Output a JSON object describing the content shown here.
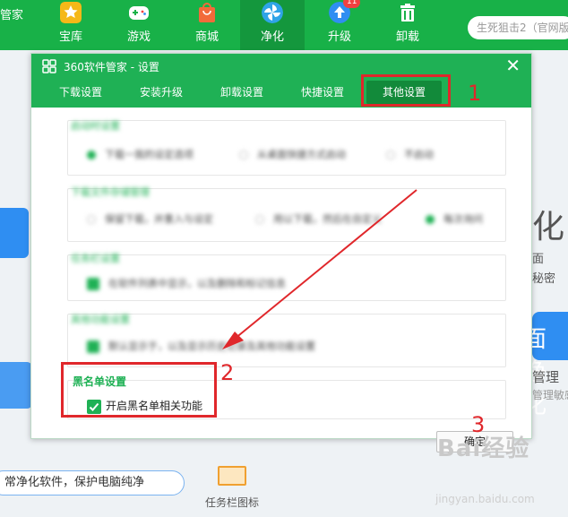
{
  "topbar": {
    "brand_fragment": "管家",
    "nav": [
      {
        "label": "宝库",
        "icon": "star-icon",
        "color": "#f5b818"
      },
      {
        "label": "游戏",
        "icon": "gamepad-icon",
        "color": "#ffffff"
      },
      {
        "label": "商城",
        "icon": "shopping-bag-icon",
        "color": "#f26b3a"
      },
      {
        "label": "净化",
        "icon": "fan-icon",
        "color": "#2fa4e7",
        "active": true
      },
      {
        "label": "升级",
        "icon": "upgrade-arrow-icon",
        "color": "#2f8ef2",
        "badge": "11"
      },
      {
        "label": "卸载",
        "icon": "trash-icon",
        "color": "#ffffff"
      }
    ],
    "search_placeholder": "生死狙击2（官网版"
  },
  "background": {
    "side_char": "化",
    "side_text_1": "面",
    "side_text_2": "秘密",
    "side_text_3": "面净化",
    "side_text_4": "管理",
    "side_text_5": "管理敏感",
    "bottom_pill": "常净化软件，保护电脑纯净",
    "tray_label": "任务栏图标"
  },
  "dialog": {
    "title": "360软件管家 - 设置",
    "tabs": [
      {
        "label": "下载设置"
      },
      {
        "label": "安装升级"
      },
      {
        "label": "卸载设置"
      },
      {
        "label": "快捷设置"
      },
      {
        "label": "其他设置",
        "active": true
      }
    ],
    "blurred": {
      "sec1_title": "启动时设置",
      "sec1_opts": [
        "下载一我的设定选项",
        "从桌面快捷方式启动",
        "不启动"
      ],
      "sec2_title": "下载文件存储管理",
      "sec2_opts": [
        "保留下载，并重入与设定",
        "用以下载，然后在自定义",
        "每次询问"
      ],
      "sec3_title": "任务栏设置",
      "sec3_opt": "在软件列表中显示，以及删除和标记信息",
      "sec4_title": "其他功能设置",
      "sec4_opt": "默认显示于，以及显示历史记录及其他功能设置"
    },
    "blacklist_title": "黑名单设置",
    "blacklist_option": "开启黑名单相关功能",
    "confirm_label": "确定"
  },
  "annotations": [
    "1",
    "2",
    "3"
  ],
  "watermark": {
    "text": "Bai经验",
    "sub": "jingyan.baidu.com"
  }
}
